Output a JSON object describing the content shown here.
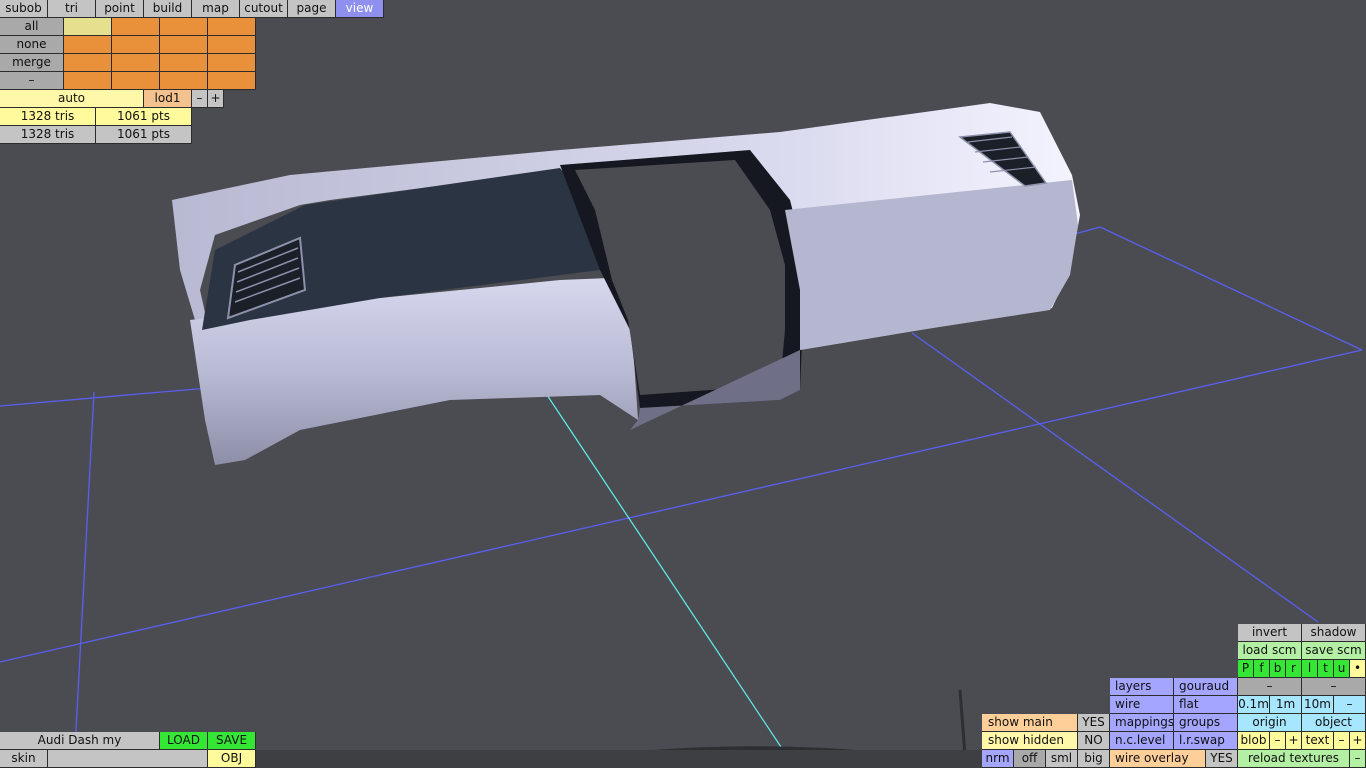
{
  "menu": [
    "subob",
    "tri",
    "point",
    "build",
    "map",
    "cutout",
    "page",
    "view"
  ],
  "select_labels": [
    "all",
    "none",
    "merge",
    "–"
  ],
  "lod": {
    "auto": "auto",
    "lod1": "lod1",
    "minus": "–",
    "plus": "+"
  },
  "stats": [
    {
      "tris": "1328 tris",
      "pts": "1061 pts"
    },
    {
      "tris": "1328 tris",
      "pts": "1061 pts"
    }
  ],
  "file": {
    "name": "Audi Dash my",
    "load": "LOAD",
    "save": "SAVE",
    "skin": "skin",
    "obj": "OBJ"
  },
  "vis": {
    "show_main": "show main",
    "show_main_val": "YES",
    "show_hidden": "show hidden",
    "show_hidden_val": "NO",
    "nrm": "nrm",
    "off": "off",
    "sml": "sml",
    "big": "big"
  },
  "render": {
    "layers": "layers",
    "gouraud": "gouraud",
    "wire": "wire",
    "flat": "flat",
    "mappings": "mappings",
    "groups": "groups",
    "nc_level": "n.c.level",
    "lr_swap": "l.r.swap",
    "wire_overlay": "wire overlay",
    "wire_overlay_val": "YES"
  },
  "scm": {
    "invert": "invert",
    "shadow": "shadow",
    "load_scm": "load scm",
    "save_scm": "save scm",
    "views": [
      "P",
      "f",
      "b",
      "r",
      "l",
      "t",
      "u",
      "•"
    ],
    "dash1": "–",
    "dash2": "–"
  },
  "grid": {
    "g01": "0.1m",
    "g1": "1m",
    "g10": "10m",
    "gminus": "–",
    "origin": "origin",
    "object": "object",
    "blob": "blob",
    "blob_minus": "–",
    "blob_plus": "+",
    "text": "text",
    "text_minus": "–",
    "text_plus": "+",
    "reload": "reload textures",
    "reload_minus": "–"
  },
  "colors": {
    "background": "#4a4c51",
    "grid_line": "#5a5ff0",
    "axis_line": "#5fe6e6",
    "model": "#c8c9df"
  }
}
